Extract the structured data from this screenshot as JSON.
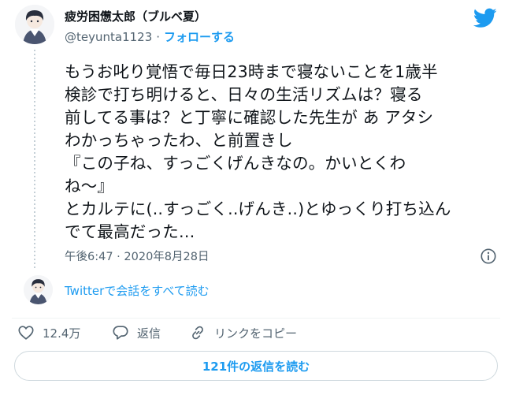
{
  "author": {
    "display_name": "疲労困憊太郎（ブルベ夏）",
    "handle": "@teyunta1123",
    "separator": "·",
    "follow_label": "フォローする"
  },
  "tweet": {
    "text": "もうお叱り覚悟で毎日23時まで寝ないことを1歳半\n検診で打ち明けると、日々の生活リズムは？寝る\n前してる事は？と丁寧に確認した先生が あ アタシ\nわかっちゃったわ、と前置きし\n『この子ね、すっごくげんきなの。かいとくわ\nね〜』\nとカルテに(..すっごく..げんき..)とゆっくり打ち込ん\nでて最高だった…",
    "timestamp": "午後6:47 · 2020年8月28日"
  },
  "conversation_link": "Twitterで会話をすべて読む",
  "actions": {
    "like_count": "12.4万",
    "reply_label": "返信",
    "copy_label": "リンクをコピー"
  },
  "replies_button": "121件の返信を読む",
  "colors": {
    "accent": "#1d9bf0",
    "like_icon": "#536471",
    "text_primary": "#0f1419",
    "text_secondary": "#536471"
  },
  "icons": [
    "twitter-bird-icon",
    "info-icon",
    "heart-icon",
    "reply-icon",
    "link-icon"
  ]
}
